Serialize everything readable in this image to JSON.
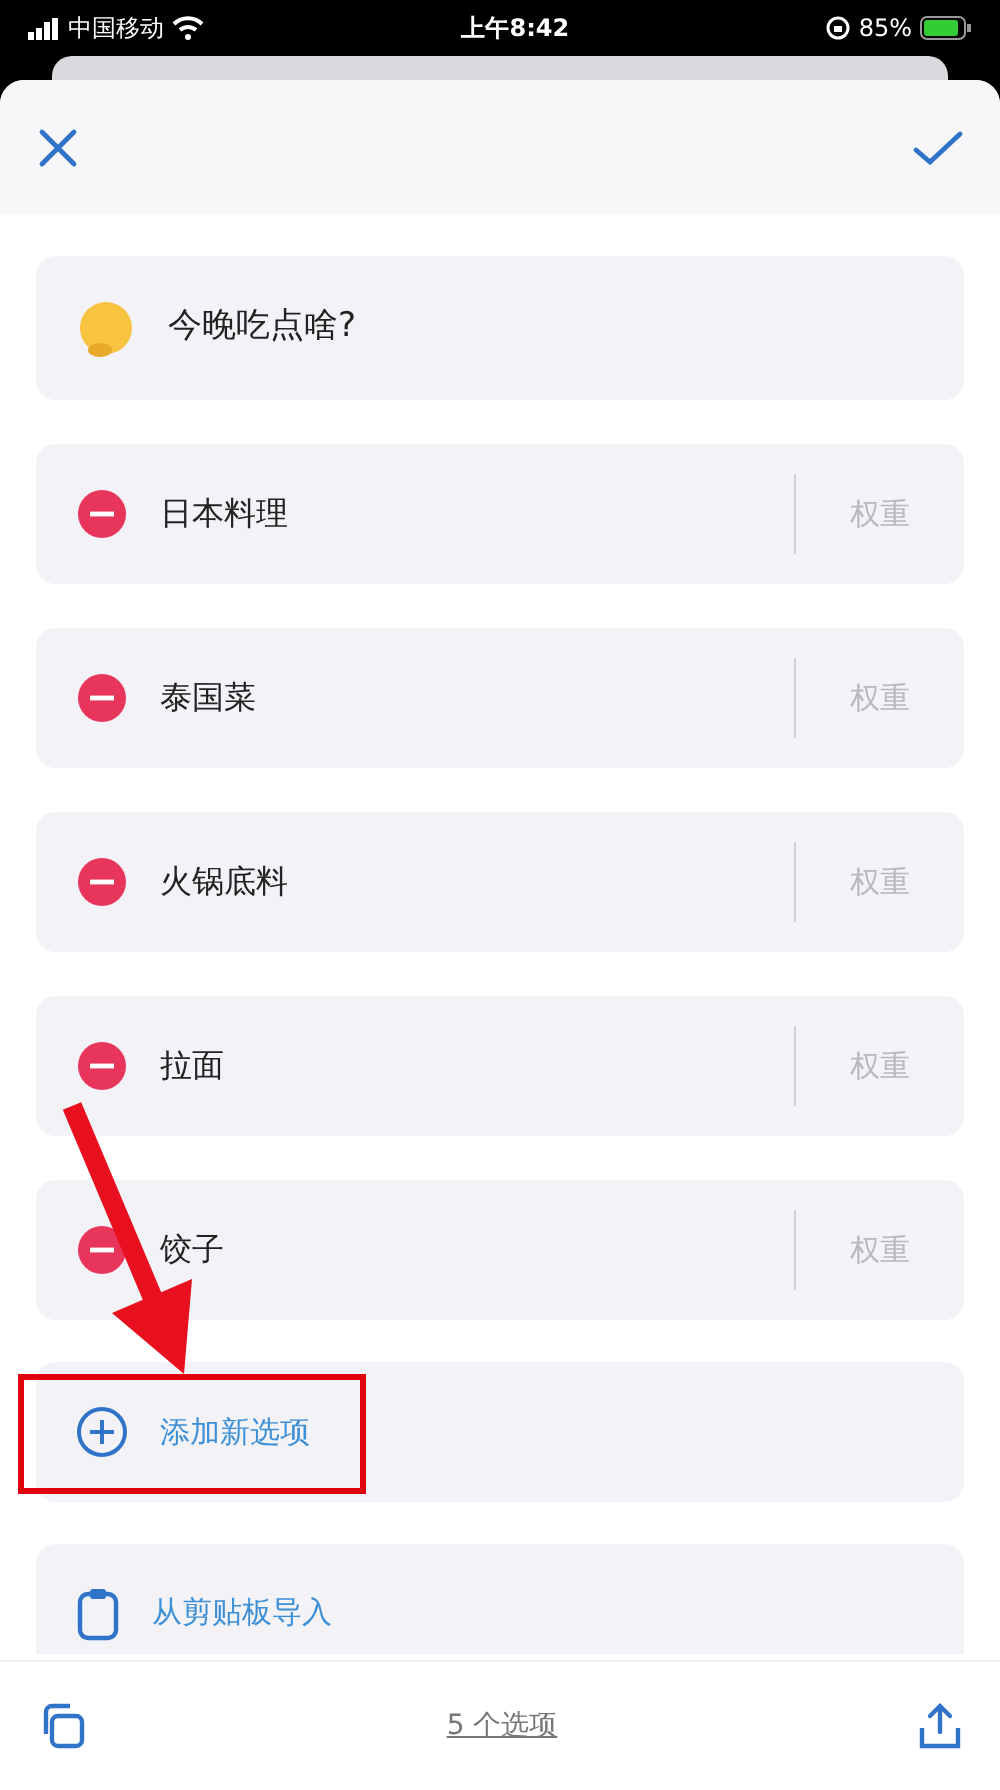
{
  "status_bar": {
    "carrier": "中国移动",
    "time": "上午8:42",
    "battery": "85%"
  },
  "title": "今晚吃点啥?",
  "options": [
    {
      "name": "日本料理",
      "weight_placeholder": "权重"
    },
    {
      "name": "泰国菜",
      "weight_placeholder": "权重"
    },
    {
      "name": "火锅底料",
      "weight_placeholder": "权重"
    },
    {
      "name": "拉面",
      "weight_placeholder": "权重"
    },
    {
      "name": "饺子",
      "weight_placeholder": "权重"
    }
  ],
  "actions": [
    {
      "kind": "add",
      "label": "添加新选项",
      "highlighted": true
    },
    {
      "kind": "paste",
      "label": "从剪贴板导入",
      "highlighted": false
    }
  ],
  "footer": {
    "count": "5 个选项"
  }
}
